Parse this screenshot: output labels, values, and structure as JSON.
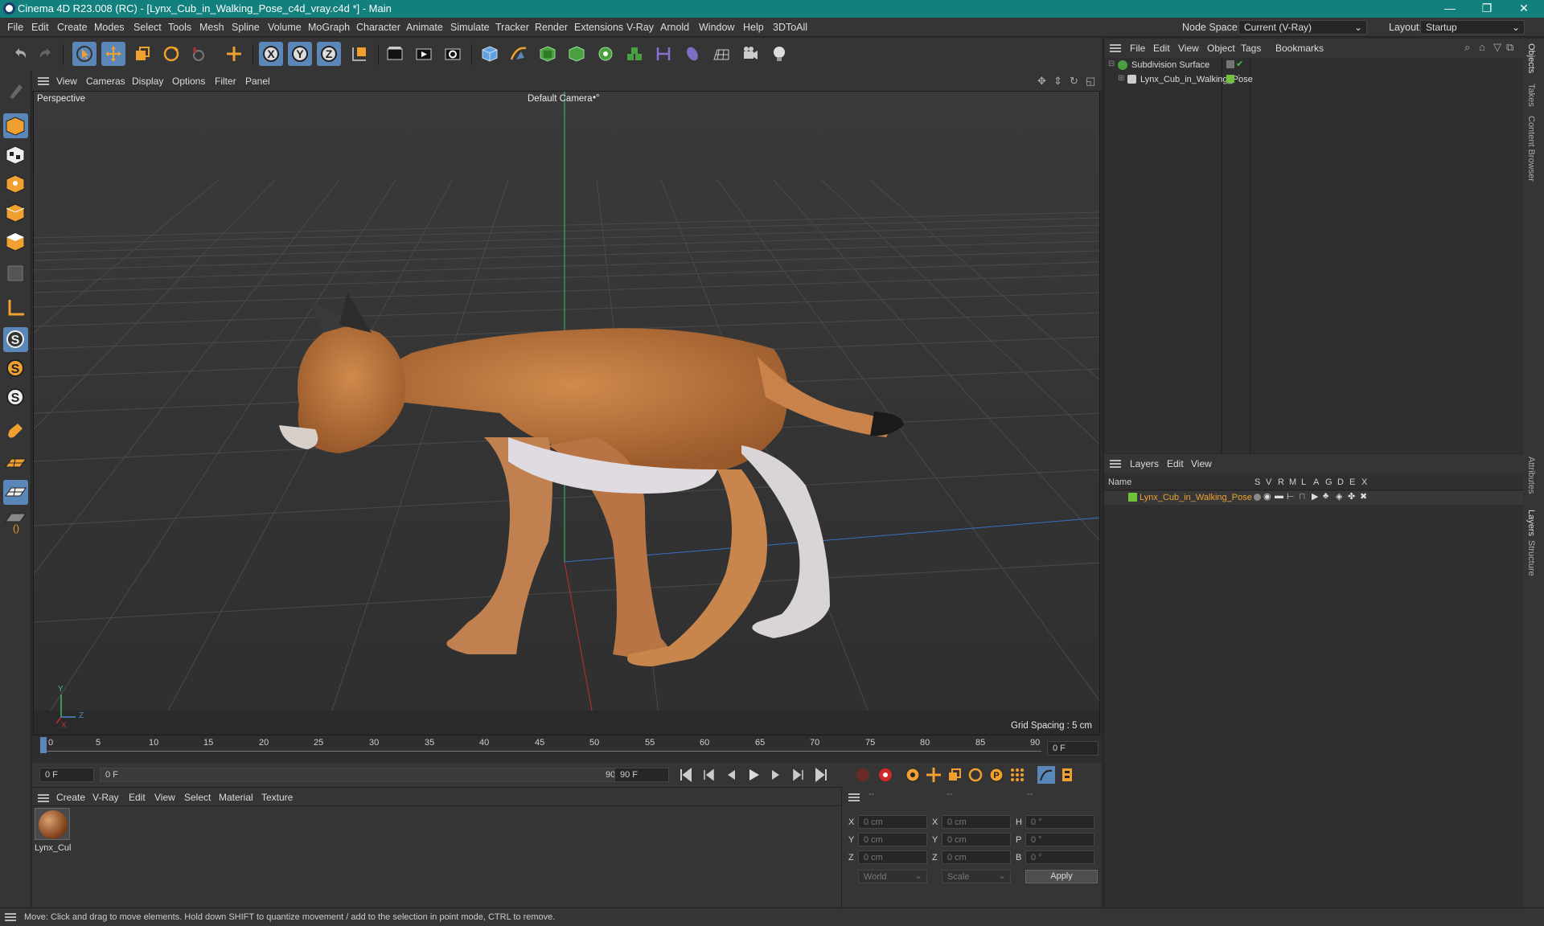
{
  "window": {
    "title": "Cinema 4D R23.008 (RC) - [Lynx_Cub_in_Walking_Pose_c4d_vray.c4d *] - Main",
    "min": "—",
    "restore": "❐",
    "close": "✕"
  },
  "menu": [
    "File",
    "Edit",
    "Create",
    "Modes",
    "Select",
    "Tools",
    "Mesh",
    "Spline",
    "Volume",
    "MoGraph",
    "Character",
    "Animate",
    "Simulate",
    "Tracker",
    "Render",
    "Extensions",
    "V-Ray",
    "Arnold",
    "Window",
    "Help",
    "3DToAll"
  ],
  "node_space": {
    "label": "Node Space:",
    "value": "Current (V-Ray)"
  },
  "layout": {
    "label": "Layout:",
    "value": "Startup"
  },
  "viewport_menu": [
    "View",
    "Cameras",
    "Display",
    "Options",
    "Filter",
    "Panel"
  ],
  "viewport": {
    "name": "Perspective",
    "camera": "Default Camera",
    "camera_icon": "•°",
    "grid_spacing": "Grid Spacing : 5 cm",
    "axis_y": "Y",
    "axis_z": "Z",
    "axis_x": "X"
  },
  "timeline": {
    "ticks": [
      "0",
      "5",
      "10",
      "15",
      "20",
      "25",
      "30",
      "35",
      "40",
      "45",
      "50",
      "55",
      "60",
      "65",
      "70",
      "75",
      "80",
      "85",
      "90"
    ],
    "current_frame": "0 F"
  },
  "transport": {
    "start": "0 F",
    "range_start": "0 F",
    "range_end": "90 F",
    "end": "90 F"
  },
  "material_menu": [
    "Create",
    "V-Ray",
    "Edit",
    "View",
    "Select",
    "Material",
    "Texture"
  ],
  "materials": [
    {
      "name": "Lynx_Cul"
    }
  ],
  "coords": {
    "headers": [
      "--",
      "--",
      "--"
    ],
    "rows": [
      {
        "a": "X",
        "av": "0 cm",
        "b": "X",
        "bv": "0 cm",
        "c": "H",
        "cv": "0 °"
      },
      {
        "a": "Y",
        "av": "0 cm",
        "b": "Y",
        "bv": "0 cm",
        "c": "P",
        "cv": "0 °"
      },
      {
        "a": "Z",
        "av": "0 cm",
        "b": "Z",
        "bv": "0 cm",
        "c": "B",
        "cv": "0 °"
      }
    ],
    "space": "World",
    "mode": "Scale",
    "apply": "Apply"
  },
  "object_manager": {
    "menu": [
      "File",
      "Edit",
      "View",
      "Object",
      "Tags",
      "Bookmarks"
    ],
    "objects": [
      {
        "name": "Subdivision Surface"
      },
      {
        "name": "Lynx_Cub_in_Walking_Pose"
      }
    ]
  },
  "layer_manager": {
    "menu": [
      "Layers",
      "Edit",
      "View"
    ],
    "columns": [
      "Name",
      "S",
      "V",
      "R",
      "M",
      "L",
      "A",
      "G",
      "D",
      "E",
      "X"
    ],
    "layers": [
      {
        "name": "Lynx_Cub_in_Walking_Pose",
        "color": "#6fc23a"
      }
    ]
  },
  "side_tabs": [
    "Objects",
    "Takes",
    "Content Browser",
    "Attributes",
    "Layers",
    "Structure"
  ],
  "status": "Move: Click and drag to move elements. Hold down SHIFT to quantize movement / add to the selection in point mode, CTRL to remove.",
  "colors": {
    "titlebar": "#12807d",
    "accent": "#f0a030",
    "selected_layer_text": "#f0a030"
  }
}
